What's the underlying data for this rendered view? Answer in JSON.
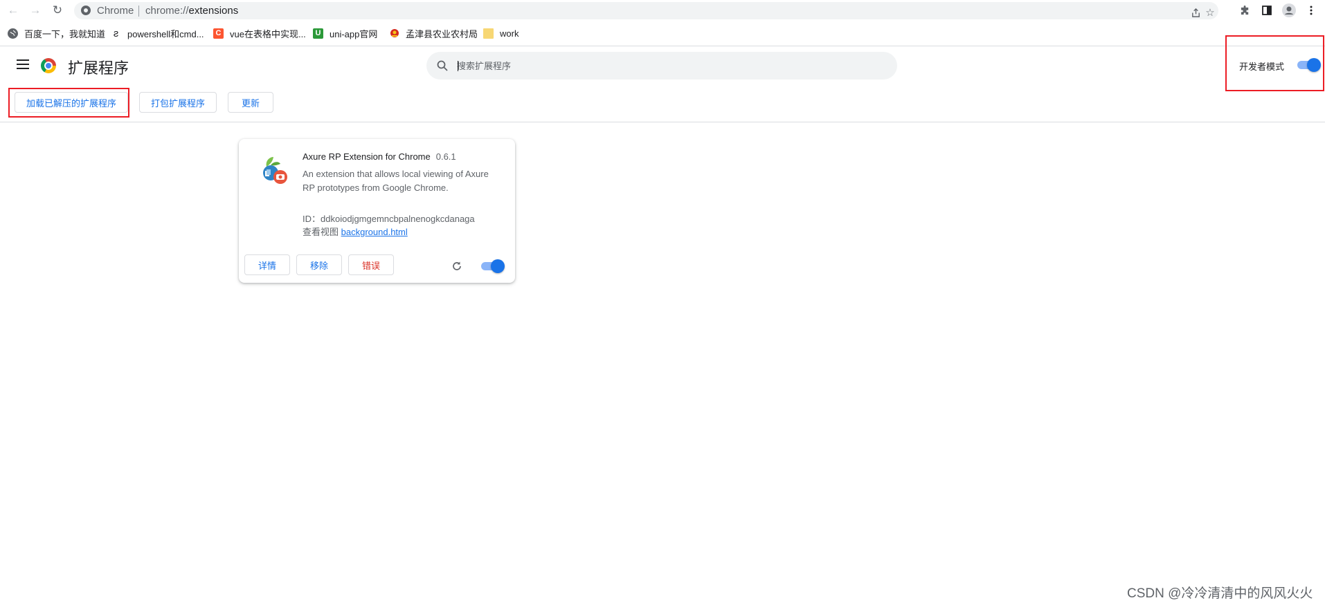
{
  "browser": {
    "omnibox_chip": "Chrome",
    "url_scheme": "chrome://",
    "url_host": "extensions"
  },
  "bookmarks": [
    {
      "label": "百度一下，我就知道",
      "icon": "globe-icon"
    },
    {
      "label": "powershell和cmd...",
      "icon": "stackoverflow-icon"
    },
    {
      "label": "vue在表格中实现...",
      "icon": "csdn-icon",
      "icon_text": "C",
      "color": "#fc5531"
    },
    {
      "label": "uni-app官网",
      "icon": "uniapp-icon",
      "icon_text": "U",
      "color": "#2b9939"
    },
    {
      "label": "孟津县农业农村局",
      "icon": "emblem-icon"
    },
    {
      "label": "work",
      "icon": "folder-icon",
      "color": "#f7d774"
    }
  ],
  "header": {
    "title": "扩展程序",
    "search_placeholder": "搜索扩展程序",
    "dev_mode_label": "开发者模式",
    "dev_mode_on": true
  },
  "toolbar": {
    "load_unpacked": "加载已解压的扩展程序",
    "pack": "打包扩展程序",
    "update": "更新"
  },
  "extension": {
    "name": "Axure RP Extension for Chrome",
    "version": "0.6.1",
    "description": "An extension that allows local viewing of Axure RP prototypes from Google Chrome.",
    "id_label": "ID：",
    "id": "ddkoiodjgmgemncbpalnenogkcdanaga",
    "views_label": "查看视图",
    "view_link": "background.html",
    "details_button": "详情",
    "remove_button": "移除",
    "errors_button": "错误",
    "enabled": true
  },
  "watermark": "CSDN @冷冷清清中的风风火火",
  "colors": {
    "accent": "#1a73e8",
    "error": "#d93025",
    "highlight": "#ec1c24"
  }
}
